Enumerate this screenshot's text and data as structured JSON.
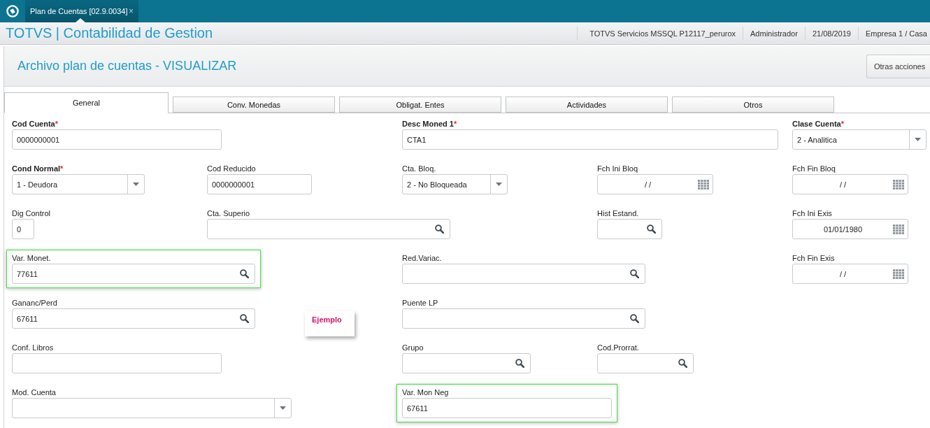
{
  "top_bar": {
    "tabs": [
      {
        "label": "Plan de Cuentas [02.9.0034]",
        "close": "×",
        "selected": true
      }
    ]
  },
  "header": {
    "title": "TOTVS | Contabilidad de Gestion",
    "info": [
      "TOTVS Servicios MSSQL P12117_perurox",
      "Administrador",
      "21/08/2019",
      "Empresa 1 / Casa"
    ]
  },
  "page": {
    "title": "Archivo plan de cuentas - VISUALIZAR",
    "actions": [
      "Otras acciones"
    ]
  },
  "tabs": [
    {
      "label": "General",
      "selected": true
    },
    {
      "label": "Conv. Monedas",
      "selected": false
    },
    {
      "label": "Obligat. Entes",
      "selected": false
    },
    {
      "label": "Actividades",
      "selected": false
    },
    {
      "label": "Otros",
      "selected": false
    }
  ],
  "form": {
    "rows": [
      {
        "fields": [
          {
            "kind": "text",
            "label": "Cod Cuenta",
            "required": true,
            "mark": "*",
            "value": "0000000001",
            "highlighted": false
          },
          {
            "kind": "text",
            "label": "Desc Moned 1",
            "required": true,
            "mark": "*",
            "value": "CTA1",
            "highlighted": false
          },
          {
            "kind": "select",
            "label": "Clase Cuenta",
            "required": true,
            "mark": "*",
            "value": "2 - Analitica",
            "highlighted": false
          }
        ]
      },
      {
        "fields": [
          {
            "kind": "select",
            "label": "Cond Normal",
            "required": true,
            "mark": "*",
            "value": "1 - Deudora",
            "highlighted": false
          },
          {
            "kind": "text",
            "label": "Cod Reducido",
            "required": false,
            "value": "0000000001",
            "highlighted": false
          },
          {
            "kind": "select",
            "label": "Cta. Bloq.",
            "required": false,
            "value": "2 - No Bloqueada",
            "highlighted": false
          },
          {
            "kind": "date",
            "label": "Fch Ini Bloq",
            "required": false,
            "value": "/ /",
            "highlighted": false
          },
          {
            "kind": "date",
            "label": "Fch Fin Bloq",
            "required": false,
            "value": "/ /",
            "highlighted": false
          }
        ]
      },
      {
        "fields": [
          {
            "kind": "text",
            "label": "Dig Control",
            "required": false,
            "value": "0",
            "highlighted": false
          },
          {
            "kind": "lookup",
            "label": "Cta. Superio",
            "required": false,
            "highlighted": false
          },
          {
            "kind": "lookup",
            "label": "Hist Estand.",
            "required": false,
            "highlighted": false
          },
          {
            "kind": "date",
            "label": "Fch Ini Exis",
            "required": false,
            "value": "01/01/1980",
            "highlighted": false
          }
        ]
      },
      {
        "fields": [
          {
            "kind": "lookup",
            "label": "Var. Monet.",
            "required": false,
            "value": "77611",
            "highlighted": true
          },
          {
            "kind": "lookup",
            "label": "Red.Variac.",
            "required": false,
            "highlighted": false
          },
          {
            "kind": "date",
            "label": "Fch Fin Exis",
            "required": false,
            "value": "/ /",
            "highlighted": false
          }
        ]
      },
      {
        "fields": [
          {
            "kind": "lookup",
            "label": "Gananc/Perd",
            "required": false,
            "value": "67611",
            "highlighted": false
          },
          {
            "kind": "lookup",
            "label": "Puente LP",
            "required": false,
            "highlighted": false
          }
        ]
      },
      {
        "fields": [
          {
            "kind": "text",
            "label": "Conf. Libros",
            "required": false,
            "highlighted": false
          },
          {
            "kind": "lookup",
            "label": "Grupo",
            "required": false,
            "highlighted": false
          },
          {
            "kind": "lookup",
            "label": "Cod.Prorrat.",
            "required": false,
            "highlighted": false
          }
        ]
      },
      {
        "fields": [
          {
            "kind": "select",
            "label": "Mod. Cuenta",
            "required": false,
            "highlighted": false
          },
          {
            "kind": "text",
            "label": "Var. Mon Neg",
            "required": false,
            "value": "67611",
            "highlighted": true
          }
        ]
      }
    ]
  },
  "note": {
    "text": "Ejemplo"
  }
}
